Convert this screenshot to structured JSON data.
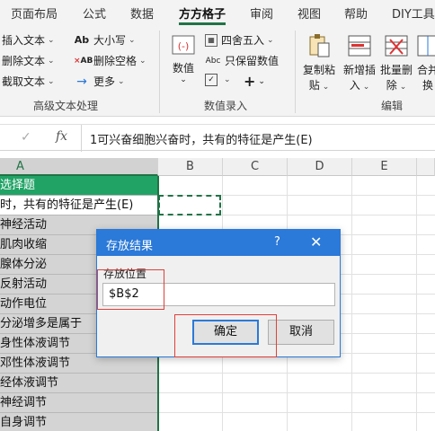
{
  "ribbon_tabs": [
    {
      "label": "页面布局"
    },
    {
      "label": "公式"
    },
    {
      "label": "数据"
    },
    {
      "label": "方方格子"
    },
    {
      "label": "审阅"
    },
    {
      "label": "视图"
    },
    {
      "label": "帮助"
    },
    {
      "label": "DIY工具"
    }
  ],
  "ribbon": {
    "text_group": {
      "insert_text": "插入文本",
      "delete_text": "删除文本",
      "cut_text": "截取文本",
      "case": "大小写",
      "delete_spaces": "删除空格",
      "more": "更多",
      "label": "高级文本处理"
    },
    "number_group": {
      "number": "数值",
      "round": "四舍五入",
      "keep_values": "只保留数值",
      "label": "数值录入"
    },
    "edit_group": {
      "copy_paste_1": "复制粘",
      "copy_paste_2": "贴",
      "insert_1": "新增插",
      "insert_2": "入",
      "batch_delete_1": "批量删",
      "batch_delete_2": "除",
      "merge_1": "合并",
      "merge_2": "换",
      "label": "编辑"
    }
  },
  "formula_bar": {
    "content": "1可兴奋细胞兴奋时，共有的特征是产生(E)"
  },
  "columns": [
    "A",
    "B",
    "C",
    "D",
    "E"
  ],
  "column_a_cells": [
    "选择题",
    "时，共有的特征是产生(E)",
    "神经活动",
    "肌肉收缩",
    "腺体分泌",
    "反射活动",
    "动作电位",
    "分泌增多是属于",
    "身性体液调节",
    "邓性体液调节",
    "经体液调节",
    "神经调节",
    "自身调节"
  ],
  "dialog": {
    "title": "存放结果",
    "help": "?",
    "close": "✕",
    "field_label": "存放位置",
    "field_value": "$B$2",
    "ok": "确定",
    "cancel": "取消"
  },
  "colors": {
    "accent": "#217346",
    "header_green": "#21a366",
    "dialog_blue": "#2b79d8",
    "highlight_red": "#e0403a"
  }
}
